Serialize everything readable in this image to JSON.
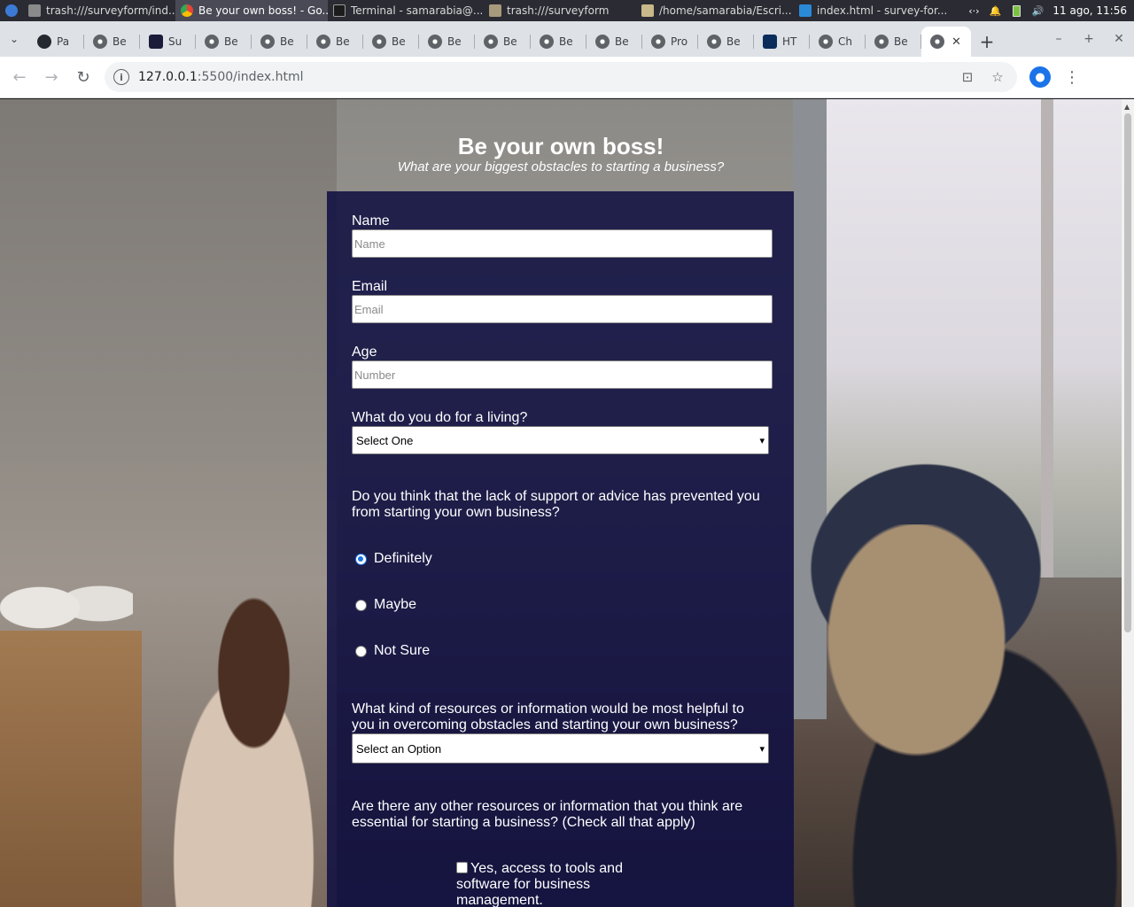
{
  "taskbar": {
    "items": [
      {
        "label": "trash:///surveyform/ind...",
        "icon": "text-editor-icon",
        "active": false
      },
      {
        "label": "Be your own boss! - Go...",
        "icon": "chrome-icon",
        "active": true
      },
      {
        "label": "Terminal - samarabia@...",
        "icon": "terminal-icon",
        "active": false
      },
      {
        "label": "trash:///surveyform",
        "icon": "folder-icon",
        "active": false
      },
      {
        "label": "/home/samarabia/Escri...",
        "icon": "folder-icon",
        "active": false
      },
      {
        "label": "index.html - survey-for...",
        "icon": "vscode-icon",
        "active": false
      }
    ],
    "clock": "11 ago, 11:56"
  },
  "browser": {
    "tabs": [
      {
        "label": "Pa",
        "icon": "github-icon"
      },
      {
        "label": "Be",
        "icon": "globe-icon"
      },
      {
        "label": "Su",
        "icon": "code-icon"
      },
      {
        "label": "Be",
        "icon": "globe-icon"
      },
      {
        "label": "Be",
        "icon": "globe-icon"
      },
      {
        "label": "Be",
        "icon": "globe-icon"
      },
      {
        "label": "Be",
        "icon": "globe-icon"
      },
      {
        "label": "Be",
        "icon": "globe-icon"
      },
      {
        "label": "Be",
        "icon": "globe-icon"
      },
      {
        "label": "Be",
        "icon": "globe-icon"
      },
      {
        "label": "Be",
        "icon": "globe-icon"
      },
      {
        "label": "Pro",
        "icon": "globe-icon"
      },
      {
        "label": "Be",
        "icon": "globe-icon"
      },
      {
        "label": "HT",
        "icon": "slash-icon"
      },
      {
        "label": "Ch",
        "icon": "globe-icon"
      },
      {
        "label": "Be",
        "icon": "globe-icon"
      }
    ],
    "url_host": "127.0.0.1",
    "url_path": ":5500/index.html"
  },
  "page": {
    "title": "Be your own boss!",
    "subtitle": "What are your biggest obstacles to starting a business?",
    "form": {
      "name_label": "Name",
      "name_placeholder": "Name",
      "email_label": "Email",
      "email_placeholder": "Email",
      "age_label": "Age",
      "age_placeholder": "Number",
      "job_label": "What do you do for a living?",
      "job_selected": "Select One",
      "support_question": "Do you think that the lack of support or advice has prevented you from starting your own business?",
      "support_options": [
        "Definitely",
        "Maybe",
        "Not Sure"
      ],
      "support_selected": "Definitely",
      "resources_question": "What kind of resources or information would be most helpful to you in overcoming obstacles and starting your own business?",
      "resources_selected": "Select an Option",
      "other_question": "Are there any other resources or information that you think are essential for starting a business? (Check all that apply)",
      "other_options": [
        "Yes, access to tools and software for business management."
      ]
    }
  },
  "colors": {
    "form_bg": "#101042",
    "radio_accent": "#1a73e8",
    "chrome_tabstrip": "#dee1e6"
  }
}
